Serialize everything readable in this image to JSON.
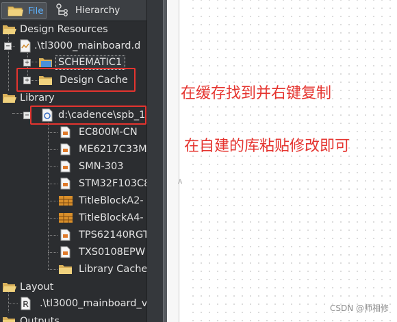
{
  "tabs": {
    "file": "File",
    "hierarchy": "Hierarchy"
  },
  "tree": {
    "design_resources": "Design Resources",
    "design_file": ".\\tl3000_mainboard.d",
    "schematic": "SCHEMATIC1",
    "design_cache": "Design Cache",
    "library": "Library",
    "library_path": "d:\\cadence\\spb_1",
    "parts": [
      "EC800M-CN",
      "ME6217C33M",
      "SMN-303",
      "STM32F103C8",
      "TitleBlockA2-",
      "TitleBlockA4-",
      "TPS62140RGT",
      "TXS0108EPW",
      "Library Cache"
    ],
    "layout": "Layout",
    "layout_file": ".\\tl3000_mainboard_v",
    "outputs": "Outputs"
  },
  "annotations": {
    "note1": "在缓存找到并右键复制",
    "note2": "在自建的库粘贴修改即可"
  },
  "canvas_marker": "A",
  "watermark": "CSDN @师相修",
  "colors": {
    "panel_bg": "#2b2d30",
    "accent_tab": "#5db2ff",
    "annotation_red": "#e5342f",
    "folder": "#e6c26a"
  }
}
